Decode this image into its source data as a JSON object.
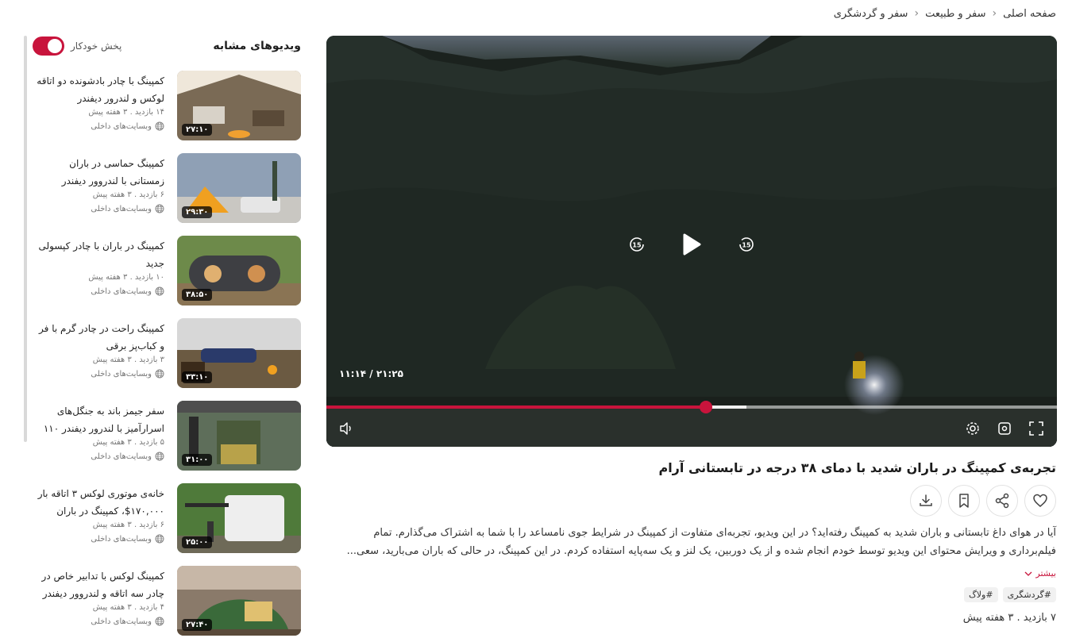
{
  "breadcrumb": {
    "home": "صفحه اصلی",
    "category": "سفر و طبیعت",
    "current": "سفر و گردشگری"
  },
  "player": {
    "time": "۱۱:۱۴ / ۲۱:۲۵",
    "progress": 0.52,
    "buffered": 0.575,
    "rewind_icon": "rewind-15-icon",
    "play_icon": "play-icon",
    "forward_icon": "forward-15-icon",
    "accent": "#c8143c"
  },
  "video": {
    "title": "تجربه‌ی کمپینگ در باران شدید با دمای ۳۸ درجه در تابستانی آرام",
    "description": "آیا در هوای داغ تابستانی و باران شدید به کمپینگ رفته‌اید؟ در این ویدیو، تجربه‌ای متفاوت از کمپینگ در شرایط جوی نامساعد را با شما به اشتراک می‌گذارم. تمام فیلم‌برداری و ویرایش محتوای این ویدیو توسط خودم انجام شده و از یک دوربین، یک لنز و یک سه‌پایه استفاده کردم. در این کمپینگ، در حالی که باران می‌بارید، سعی...",
    "more": "بیشتر",
    "tags": [
      "#گردشگری",
      "#ولاگ"
    ],
    "meta": "۷ بازدید  .  ۳ هفته پیش"
  },
  "sidebar": {
    "title": "ویدیوهای مشابه",
    "autoplay_label": "پخش خودکار",
    "autoplay_on": true,
    "items": [
      {
        "title": "کمپینگ با چادر بادشونده دو اتاقه لوکس و لندرور دیفندر",
        "meta": "۱۴ بازدید  .  ۳ هفته پیش",
        "channel": "وبسایت‌های داخلی",
        "duration": "۲۷:۱۰"
      },
      {
        "title": "کمپینگ حماسی در باران زمستانی با لندروور دیفندر",
        "meta": "۶ بازدید  .  ۳ هفته پیش",
        "channel": "وبسایت‌های داخلی",
        "duration": "۲۹:۳۰"
      },
      {
        "title": "کمپینگ در باران با چادر کپسولی جدید",
        "meta": "۱۰ بازدید  .  ۳ هفته پیش",
        "channel": "وبسایت‌های داخلی",
        "duration": "۳۸:۵۰"
      },
      {
        "title": "کمپینگ راحت در چادر گرم با فر و کباب‌پز برقی",
        "meta": "۳ بازدید  .  ۳ هفته پیش",
        "channel": "وبسایت‌های داخلی",
        "duration": "۳۳:۱۰"
      },
      {
        "title": "سفر جیمز باند به جنگل‌های اسرارآمیز با لندرور دیفندر ۱۱۰",
        "meta": "۵ بازدید  .  ۳ هفته پیش",
        "channel": "وبسایت‌های داخلی",
        "duration": "۳۱:۰۰"
      },
      {
        "title": "خانه‌ی موتوری لوکس ۳ اتاقه بار ۱۷۰,۰۰۰$، کمپینگ در باران",
        "meta": "۶ بازدید  .  ۳ هفته پیش",
        "channel": "وبسایت‌های داخلی",
        "duration": "۲۵:۰۰"
      },
      {
        "title": "کمپینگ لوکس با تدابیر خاص در چادر سه اتاقه و لندروور دیفندر",
        "meta": "۴ بازدید  .  ۳ هفته پیش",
        "channel": "وبسایت‌های داخلی",
        "duration": "۲۷:۴۰"
      }
    ]
  }
}
